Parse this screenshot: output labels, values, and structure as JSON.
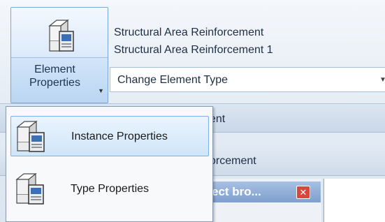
{
  "ribbon": {
    "element_properties": {
      "label_line1": "Element",
      "label_line2": "Properties",
      "icon": "element-properties-icon"
    },
    "type_selector": {
      "family": "Structural Area Reinforcement",
      "type": "Structural Area Reinforcement 1",
      "change_type_label": "Change Element Type"
    }
  },
  "background": {
    "band1_text": "ent",
    "band2_text": "orcement",
    "project_browser_title": "ect bro...",
    "close_glyph": "✕"
  },
  "menu": {
    "items": [
      {
        "label": "Instance Properties",
        "icon": "instance-properties-icon",
        "selected": true
      },
      {
        "label": "Type Properties",
        "icon": "type-properties-icon",
        "selected": false
      }
    ]
  },
  "colors": {
    "accent": "#79a7d8",
    "close_button": "#d9463c",
    "selection": "#cfe5f9"
  }
}
